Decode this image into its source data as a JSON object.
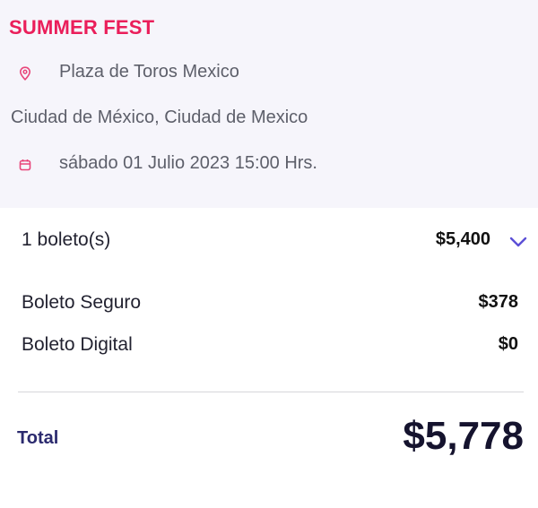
{
  "event": {
    "title": "SUMMER FEST",
    "venue": "Plaza de Toros Mexico",
    "city": "Ciudad de México, Ciudad de Mexico",
    "date": "sábado 01 Julio 2023 15:00 Hrs.",
    "venue_icon": "map-pin-icon",
    "date_icon": "calendar-icon"
  },
  "summary": {
    "tickets_label": "1 boleto(s)",
    "tickets_price": "$5,400",
    "expand_icon": "chevron-down-icon",
    "insurance_label": "Boleto Seguro",
    "insurance_price": "$378",
    "digital_label": "Boleto Digital",
    "digital_price": "$0",
    "total_label": "Total",
    "total_value": "$5,778"
  },
  "colors": {
    "title": "#ea1e5a",
    "icon": "#e8457a",
    "chevron": "#5b4fd6",
    "total_label": "#2b2a6e",
    "header_bg": "#f6f5fb"
  }
}
